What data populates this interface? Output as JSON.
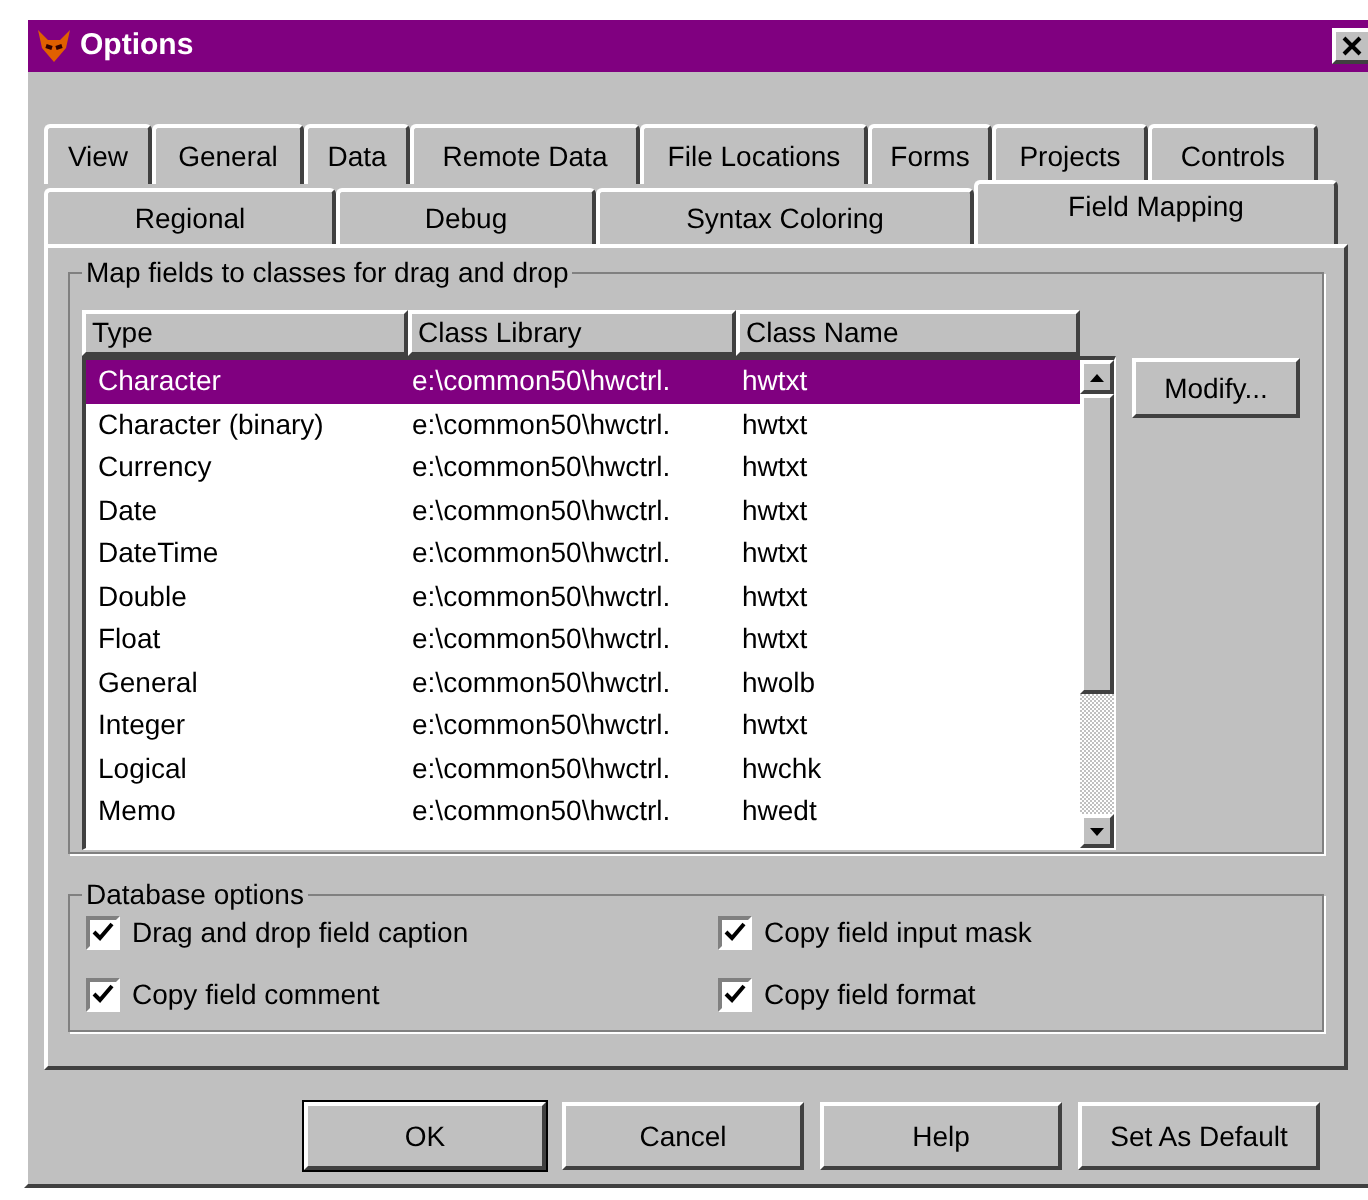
{
  "window": {
    "title": "Options"
  },
  "tab_rows": [
    {
      "tabs": [
        {
          "label": "View",
          "selected": false
        },
        {
          "label": "General",
          "selected": false
        },
        {
          "label": "Data",
          "selected": false
        },
        {
          "label": "Remote Data",
          "selected": false
        },
        {
          "label": "File Locations",
          "selected": false
        },
        {
          "label": "Forms",
          "selected": false
        },
        {
          "label": "Projects",
          "selected": false
        },
        {
          "label": "Controls",
          "selected": false
        }
      ]
    },
    {
      "tabs": [
        {
          "label": "Regional",
          "selected": false
        },
        {
          "label": "Debug",
          "selected": false
        },
        {
          "label": "Syntax Coloring",
          "selected": false
        },
        {
          "label": "Field Mapping",
          "selected": true
        }
      ]
    }
  ],
  "mapping_group": {
    "title": "Map fields to classes for drag and drop",
    "columns": [
      "Type",
      "Class Library",
      "Class Name"
    ],
    "rows": [
      {
        "type": "Character",
        "class_library": "e:\\common50\\hwctrl.",
        "class_name": "hwtxt",
        "selected": true
      },
      {
        "type": "Character (binary)",
        "class_library": "e:\\common50\\hwctrl.",
        "class_name": "hwtxt",
        "selected": false
      },
      {
        "type": "Currency",
        "class_library": "e:\\common50\\hwctrl.",
        "class_name": "hwtxt",
        "selected": false
      },
      {
        "type": "Date",
        "class_library": "e:\\common50\\hwctrl.",
        "class_name": "hwtxt",
        "selected": false
      },
      {
        "type": "DateTime",
        "class_library": "e:\\common50\\hwctrl.",
        "class_name": "hwtxt",
        "selected": false
      },
      {
        "type": "Double",
        "class_library": "e:\\common50\\hwctrl.",
        "class_name": "hwtxt",
        "selected": false
      },
      {
        "type": "Float",
        "class_library": "e:\\common50\\hwctrl.",
        "class_name": "hwtxt",
        "selected": false
      },
      {
        "type": "General",
        "class_library": "e:\\common50\\hwctrl.",
        "class_name": "hwolb",
        "selected": false
      },
      {
        "type": "Integer",
        "class_library": "e:\\common50\\hwctrl.",
        "class_name": "hwtxt",
        "selected": false
      },
      {
        "type": "Logical",
        "class_library": "e:\\common50\\hwctrl.",
        "class_name": "hwchk",
        "selected": false
      },
      {
        "type": "Memo",
        "class_library": "e:\\common50\\hwctrl.",
        "class_name": "hwedt",
        "selected": false
      }
    ],
    "modify_button": "Modify..."
  },
  "database_options": {
    "title": "Database options",
    "options": [
      {
        "label": "Drag and drop field caption",
        "checked": true
      },
      {
        "label": "Copy field input mask",
        "checked": true
      },
      {
        "label": "Copy field comment",
        "checked": true
      },
      {
        "label": "Copy field format",
        "checked": true
      }
    ]
  },
  "buttons": [
    {
      "label": "OK",
      "default": true
    },
    {
      "label": "Cancel",
      "default": false
    },
    {
      "label": "Help",
      "default": false
    },
    {
      "label": "Set As Default",
      "default": false
    }
  ]
}
